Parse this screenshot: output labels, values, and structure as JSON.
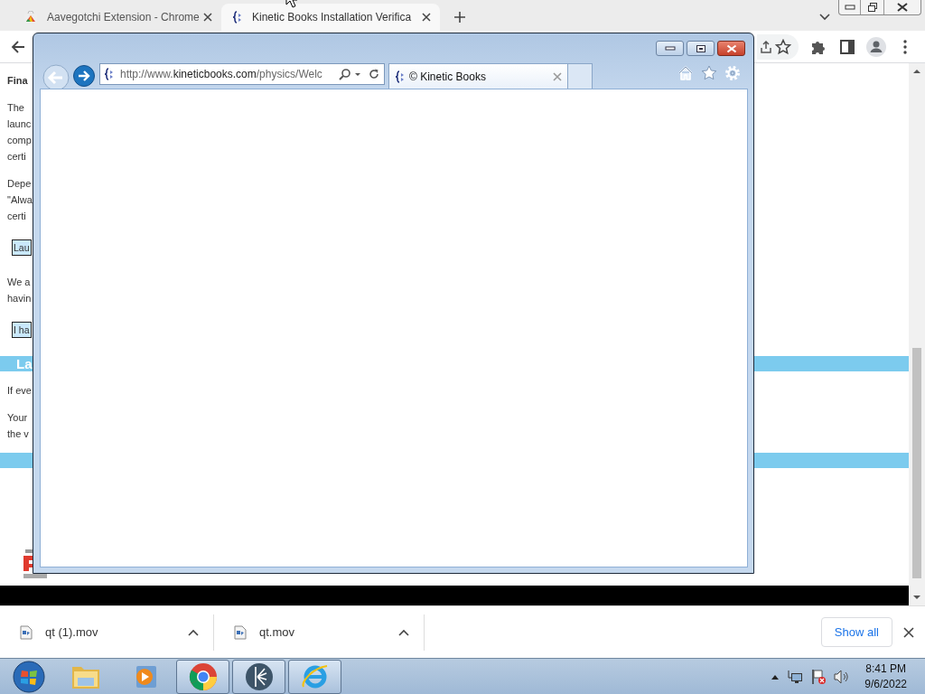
{
  "chrome_tabs": [
    {
      "title": "Aavegotchi Extension - Chrome",
      "selected": false
    },
    {
      "title": "Kinetic Books Installation Verifica",
      "selected": true
    }
  ],
  "page": {
    "blocks": [
      {
        "kind": "heading",
        "lines": [
          "Fina"
        ]
      },
      {
        "kind": "paragraph",
        "lines": [
          "The",
          "launc",
          "comp",
          "certi"
        ]
      },
      {
        "kind": "paragraph",
        "lines": [
          "Depe",
          "\"Alwa",
          "certi"
        ]
      },
      {
        "kind": "button",
        "lines": [
          "Lau"
        ]
      },
      {
        "kind": "paragraph",
        "lines": [
          "We a",
          "havin"
        ]
      },
      {
        "kind": "button",
        "lines": [
          "I ha"
        ]
      },
      {
        "kind": "banner",
        "lines": [
          "La"
        ]
      },
      {
        "kind": "paragraph",
        "lines": [
          "If eve"
        ]
      },
      {
        "kind": "paragraph",
        "lines": [
          "Your",
          "the v"
        ]
      },
      {
        "kind": "banner"
      }
    ]
  },
  "ie_window": {
    "address": "http://www.**kineticbooks.com**/physics/Welc",
    "tab_title": "© Kinetic Books"
  },
  "downloads": {
    "items": [
      {
        "name": "qt (1).mov"
      },
      {
        "name": "qt.mov"
      }
    ],
    "show_all": "Show all"
  },
  "taskbar": {
    "items": [
      {
        "kind": "start",
        "running": false
      },
      {
        "kind": "explorer",
        "running": false
      },
      {
        "kind": "media",
        "running": false
      },
      {
        "kind": "chrome",
        "running": true
      },
      {
        "kind": "kinetic",
        "running": true
      },
      {
        "kind": "ie",
        "running": true
      }
    ],
    "clock": {
      "time": "8:41 PM",
      "date": "9/6/2022"
    }
  }
}
